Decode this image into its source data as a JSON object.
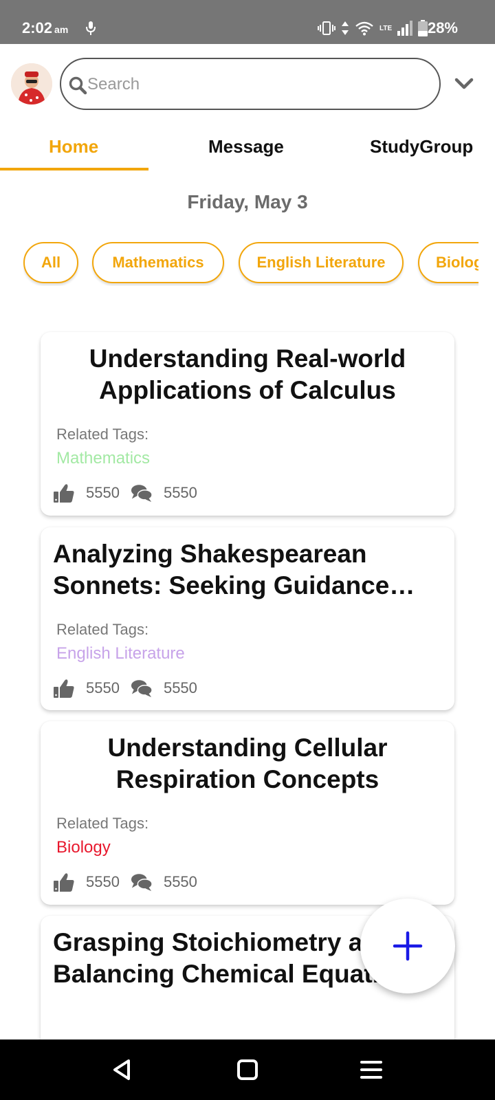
{
  "status_bar": {
    "time": "2:02",
    "ampm": "am",
    "network": "LTE",
    "battery": "28%"
  },
  "header": {
    "search_placeholder": "Search",
    "avatar_icon": "user-avatar",
    "dropdown_icon": "chevron-down-icon"
  },
  "tabs": [
    {
      "label": "Home",
      "active": true
    },
    {
      "label": "Message",
      "active": false
    },
    {
      "label": "StudyGroup",
      "active": false
    }
  ],
  "date_heading": "Friday, May 3",
  "filters": [
    "All",
    "Mathematics",
    "English Literature",
    "Biology"
  ],
  "related_tags_label": "Related Tags:",
  "posts": [
    {
      "title": "Understanding Real-world Applications of Calculus",
      "tag": "Mathematics",
      "tag_color": "#a3e9a4",
      "likes": "5550",
      "comments": "5550"
    },
    {
      "title": "Analyzing Shakespearean Sonnets: Seeking Guidance from Experts",
      "tag": "English Literature",
      "tag_color": "#c7a3e9",
      "likes": "5550",
      "comments": "5550"
    },
    {
      "title": "Understanding Cellular Respiration Concepts",
      "tag": "Biology",
      "tag_color": "#e8182d",
      "likes": "5550",
      "comments": "5550"
    },
    {
      "title": "Grasping Stoichiometry and Balancing Chemical Equations"
    }
  ],
  "fab": {
    "icon": "plus-icon",
    "color": "#1a1ae6"
  },
  "colors": {
    "accent": "#f2a60c",
    "status_bar": "#767676",
    "nav_bar": "#000000"
  }
}
